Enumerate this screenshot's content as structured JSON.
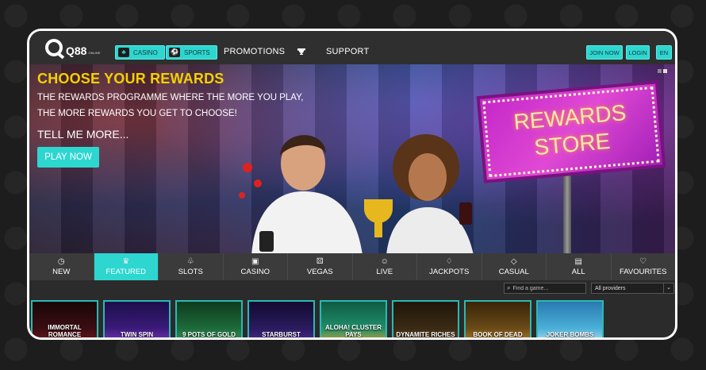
{
  "nav": {
    "logo": "Q88",
    "logo_small": "ONLINE",
    "casino": "CASINO",
    "sports": "SPORTS",
    "promotions": "PROMOTIONS",
    "support": "SUPPORT",
    "join_now": "JOIN NOW",
    "login": "LOGIN",
    "language": "EN"
  },
  "hero": {
    "title": "CHOOSE YOUR REWARDS",
    "line1": "THE REWARDS PROGRAMME WHERE THE MORE YOU PLAY,",
    "line2": "THE MORE REWARDS YOU GET TO CHOOSE!",
    "more": "TELL ME MORE...",
    "cta": "PLAY NOW",
    "sign_line1": "REWARDS",
    "sign_line2": "STORE"
  },
  "categories": [
    {
      "label": "NEW",
      "icon": "clock-icon"
    },
    {
      "label": "FEATURED",
      "icon": "crown-icon",
      "active": true
    },
    {
      "label": "SLOTS",
      "icon": "cherries-icon"
    },
    {
      "label": "CASINO",
      "icon": "cards-icon"
    },
    {
      "label": "VEGAS",
      "icon": "dice-icon"
    },
    {
      "label": "LIVE",
      "icon": "user-icon"
    },
    {
      "label": "JACKPOTS",
      "icon": "diamond-ring-icon"
    },
    {
      "label": "CASUAL",
      "icon": "diamond-icon"
    },
    {
      "label": "ALL",
      "icon": "document-icon"
    },
    {
      "label": "FAVOURITES",
      "icon": "heart-icon"
    }
  ],
  "search": {
    "placeholder": "Find a game...",
    "provider": "All providers"
  },
  "games": [
    {
      "title": "IMMORTAL ROMANCE",
      "color": "#3a0d12"
    },
    {
      "title": "TWIN SPIN",
      "color": "#3b1a7a"
    },
    {
      "title": "9 POTS OF GOLD",
      "color": "#1d6b3a"
    },
    {
      "title": "STARBURST",
      "color": "#2a1b5e"
    },
    {
      "title": "ALOHA! CLUSTER PAYS",
      "color": "#1f8f6a"
    },
    {
      "title": "DYNAMITE RICHES",
      "color": "#3a2a14"
    },
    {
      "title": "BOOK OF DEAD",
      "color": "#6a4a18"
    },
    {
      "title": "JOKER BOMBS",
      "color": "#4ab0d8"
    }
  ]
}
